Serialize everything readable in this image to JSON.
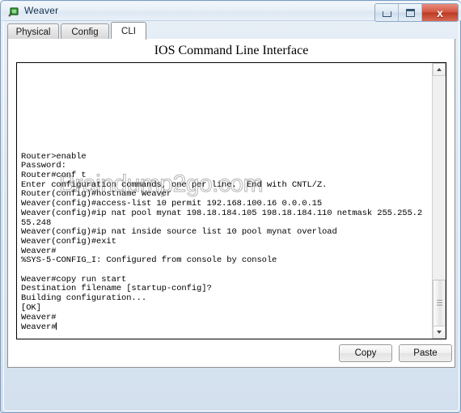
{
  "window": {
    "title": "Weaver",
    "icon": "router-device-icon",
    "controls": {
      "minimize": "minimize-icon",
      "maximize": "maximize-icon",
      "close_label": "x"
    }
  },
  "tabs": [
    {
      "id": "physical",
      "label": "Physical",
      "active": false
    },
    {
      "id": "config",
      "label": "Config",
      "active": false
    },
    {
      "id": "cli",
      "label": "CLI",
      "active": true
    }
  ],
  "cli": {
    "heading": "IOS Command Line Interface",
    "watermark": "Braindump2go.com",
    "terminal_text": "Router>enable\nPassword:\nRouter#conf t\nEnter configuration commands, one per line.  End with CNTL/Z.\nRouter(config)#hostname Weaver\nWeaver(config)#access-list 10 permit 192.168.100.16 0.0.0.15\nWeaver(config)#ip nat pool mynat 198.18.184.105 198.18.184.110 netmask 255.255.2\n55.248\nWeaver(config)#ip nat inside source list 10 pool mynat overload\nWeaver(config)#exit\nWeaver#\n%SYS-5-CONFIG_I: Configured from console by console\n\nWeaver#copy run start\nDestination filename [startup-config]?\nBuilding configuration...\n[OK]\nWeaver#\nWeaver#",
    "scrollbar": {
      "up_icon": "arrow-up-icon",
      "down_icon": "arrow-down-icon"
    }
  },
  "actions": {
    "copy_label": "Copy",
    "paste_label": "Paste"
  },
  "colors": {
    "frame": "#d3e0ee",
    "frame_border": "#7a9ec4",
    "close_button": "#c2442c",
    "terminal_bg": "#ffffff",
    "terminal_fg": "#000000"
  }
}
